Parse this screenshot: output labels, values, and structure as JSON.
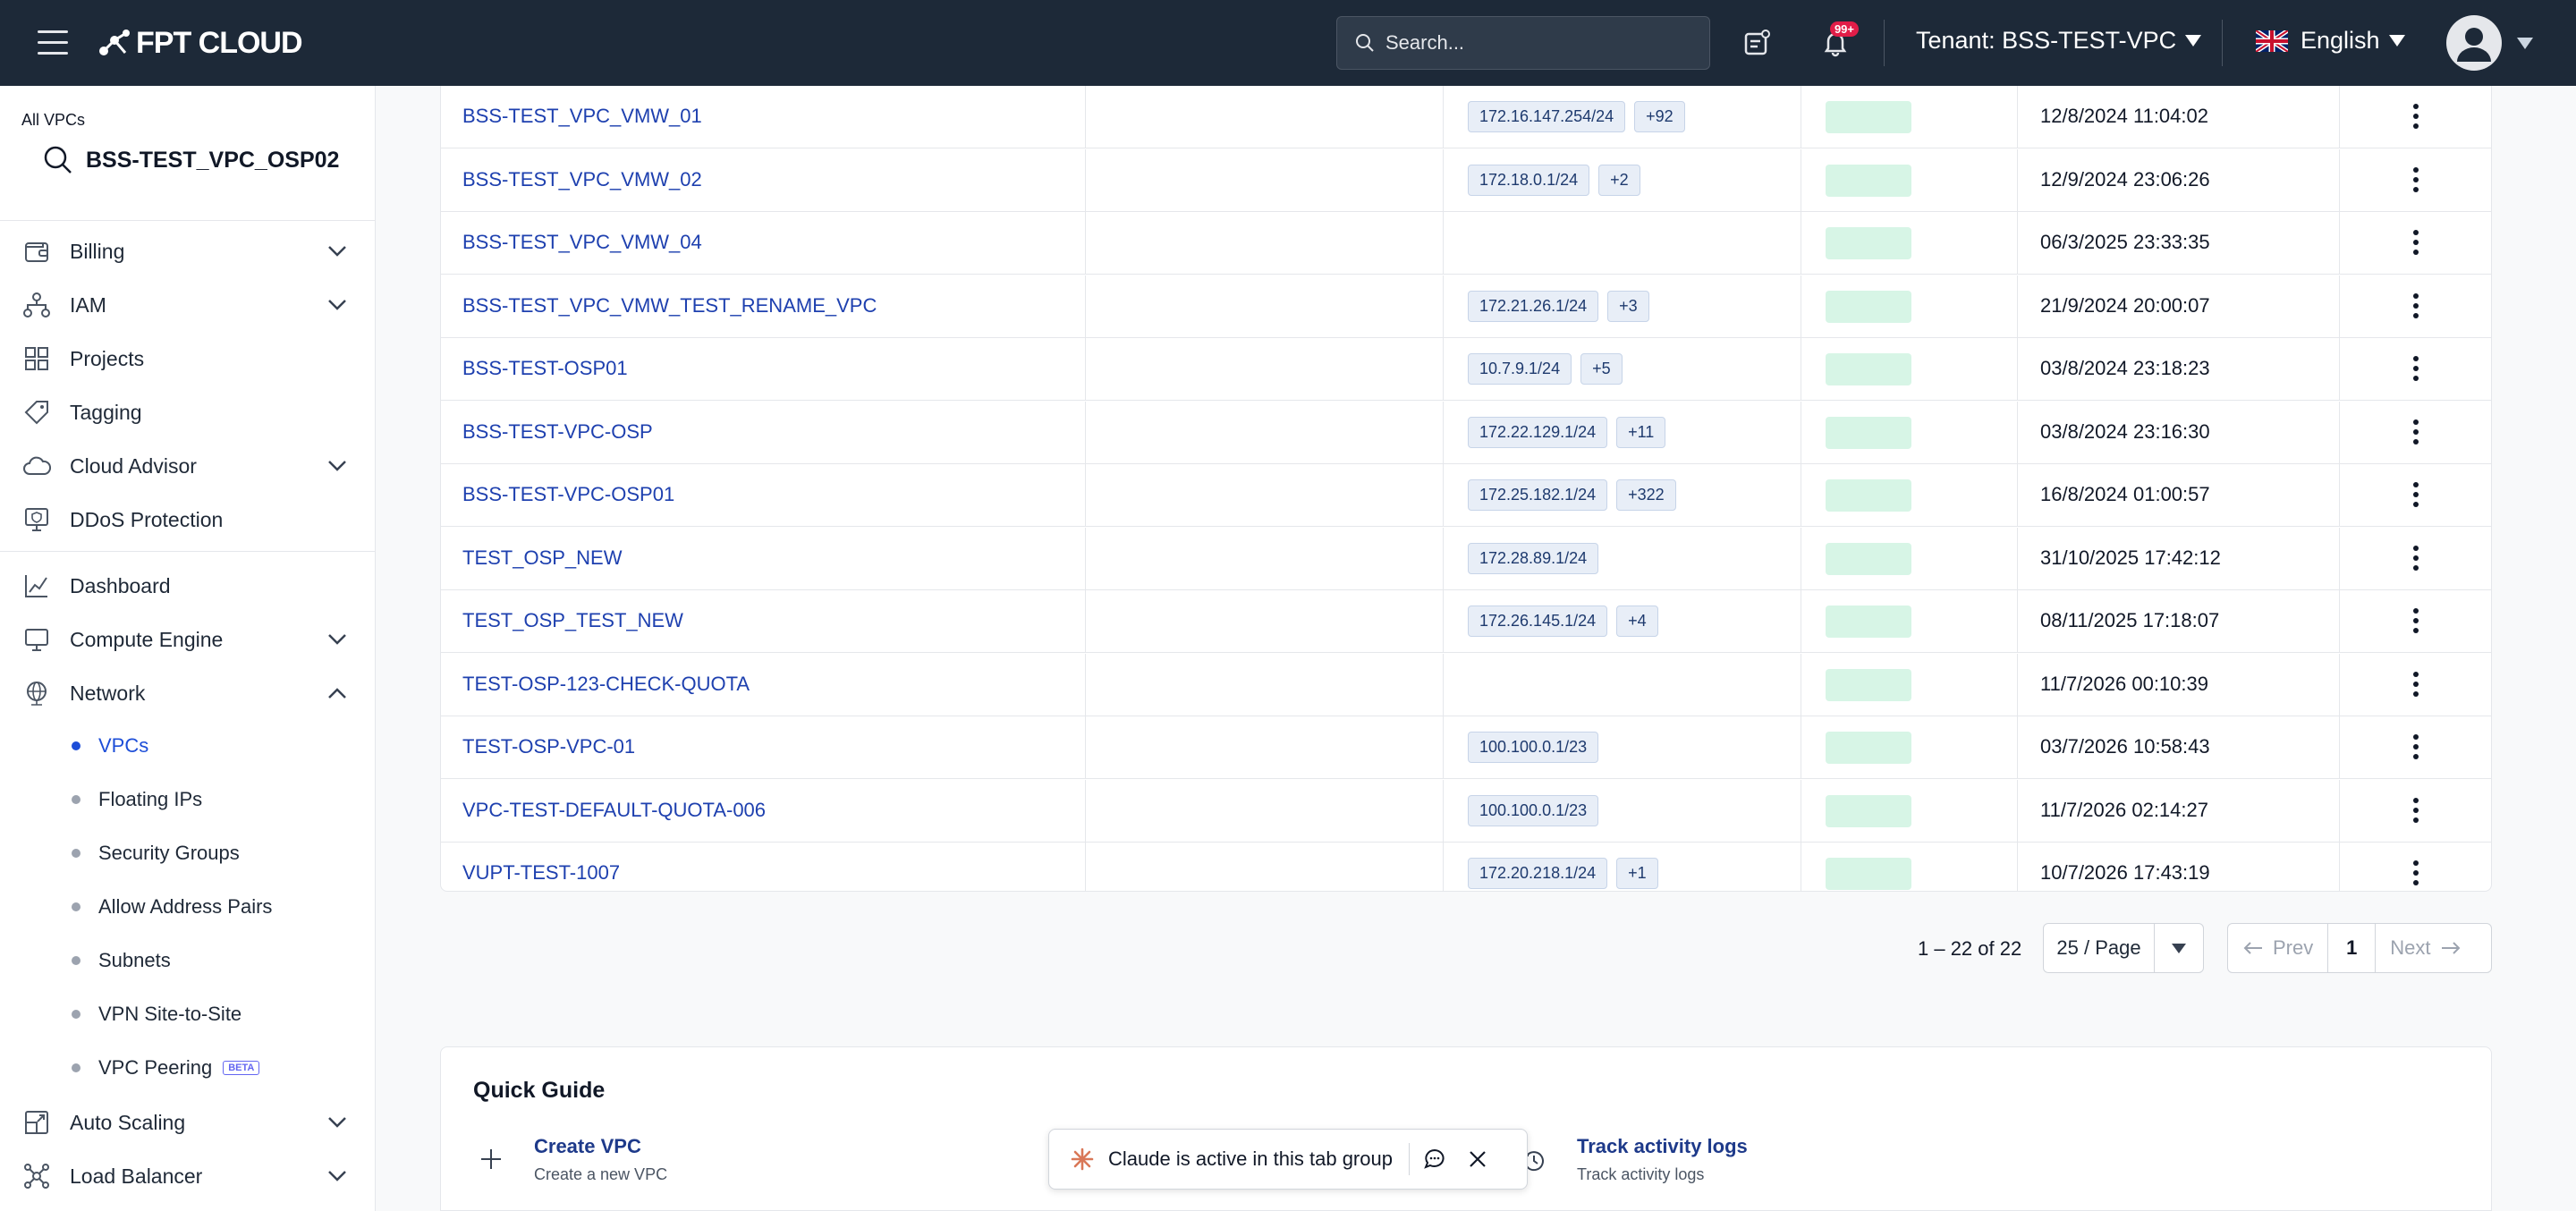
{
  "header": {
    "logo_text": "FPT CLOUD",
    "search_placeholder": "Search...",
    "notification_count": "99+",
    "tenant_label": "Tenant:",
    "tenant_value": "BSS-TEST-VPC",
    "language": "English"
  },
  "sidebar": {
    "context_title": "All VPCs",
    "context_search_value": "BSS-TEST_VPC_OSP02",
    "items": [
      {
        "label": "Billing",
        "icon": "wallet-icon",
        "expandable": true,
        "expanded": false
      },
      {
        "label": "IAM",
        "icon": "hierarchy-icon",
        "expandable": true,
        "expanded": false
      },
      {
        "label": "Projects",
        "icon": "grid-icon",
        "expandable": false
      },
      {
        "label": "Tagging",
        "icon": "tag-icon",
        "expandable": false
      },
      {
        "label": "Cloud Advisor",
        "icon": "cloud-icon",
        "expandable": true,
        "expanded": false
      },
      {
        "label": "DDoS Protection",
        "icon": "shield-monitor-icon",
        "expandable": false
      },
      {
        "label": "Dashboard",
        "icon": "chart-icon",
        "expandable": false
      },
      {
        "label": "Compute Engine",
        "icon": "monitor-icon",
        "expandable": true,
        "expanded": false
      },
      {
        "label": "Network",
        "icon": "globe-icon",
        "expandable": true,
        "expanded": true
      },
      {
        "label": "Auto Scaling",
        "icon": "scaling-icon",
        "expandable": true,
        "expanded": false
      },
      {
        "label": "Load Balancer",
        "icon": "balancer-icon",
        "expandable": true,
        "expanded": false
      }
    ],
    "network_sub_items": [
      {
        "label": "VPCs",
        "active": true
      },
      {
        "label": "Floating IPs",
        "active": false
      },
      {
        "label": "Security Groups",
        "active": false
      },
      {
        "label": "Allow Address Pairs",
        "active": false
      },
      {
        "label": "Subnets",
        "active": false
      },
      {
        "label": "VPN Site-to-Site",
        "active": false
      },
      {
        "label": "VPC Peering",
        "active": false,
        "badge": "BETA"
      }
    ]
  },
  "table": {
    "rows": [
      {
        "name": "BSS-TEST_VPC_VMW_01",
        "cidr": "172.16.147.254/24",
        "extra": "+92",
        "created": "12/8/2024 11:04:02"
      },
      {
        "name": "BSS-TEST_VPC_VMW_02",
        "cidr": "172.18.0.1/24",
        "extra": "+2",
        "created": "12/9/2024 23:06:26"
      },
      {
        "name": "BSS-TEST_VPC_VMW_04",
        "cidr": "",
        "extra": "",
        "created": "06/3/2025 23:33:35"
      },
      {
        "name": "BSS-TEST_VPC_VMW_TEST_RENAME_VPC",
        "cidr": "172.21.26.1/24",
        "extra": "+3",
        "created": "21/9/2024 20:00:07"
      },
      {
        "name": "BSS-TEST-OSP01",
        "cidr": "10.7.9.1/24",
        "extra": "+5",
        "created": "03/8/2024 23:18:23"
      },
      {
        "name": "BSS-TEST-VPC-OSP",
        "cidr": "172.22.129.1/24",
        "extra": "+11",
        "created": "03/8/2024 23:16:30"
      },
      {
        "name": "BSS-TEST-VPC-OSP01",
        "cidr": "172.25.182.1/24",
        "extra": "+322",
        "created": "16/8/2024 01:00:57"
      },
      {
        "name": "TEST_OSP_NEW",
        "cidr": "172.28.89.1/24",
        "extra": "",
        "created": "31/10/2025 17:42:12"
      },
      {
        "name": "TEST_OSP_TEST_NEW",
        "cidr": "172.26.145.1/24",
        "extra": "+4",
        "created": "08/11/2025 17:18:07"
      },
      {
        "name": "TEST-OSP-123-CHECK-QUOTA",
        "cidr": "",
        "extra": "",
        "created": "11/7/2026 00:10:39"
      },
      {
        "name": "TEST-OSP-VPC-01",
        "cidr": "100.100.0.1/23",
        "extra": "",
        "created": "03/7/2026 10:58:43"
      },
      {
        "name": "VPC-TEST-DEFAULT-QUOTA-006",
        "cidr": "100.100.0.1/23",
        "extra": "",
        "created": "11/7/2026 02:14:27"
      },
      {
        "name": "VUPT-TEST-1007",
        "cidr": "172.20.218.1/24",
        "extra": "+1",
        "created": "10/7/2026 17:43:19"
      }
    ]
  },
  "pagination": {
    "range_text": "1 – 22 of 22",
    "page_size": "25 / Page",
    "prev_label": "Prev",
    "current_page": "1",
    "next_label": "Next"
  },
  "quick_guide": {
    "title": "Quick Guide",
    "items": [
      {
        "title": "Create VPC",
        "subtitle": "Create a new VPC",
        "icon": "plus-icon"
      },
      {
        "title": "Track activity logs",
        "subtitle": "Track activity logs",
        "icon": "history-icon"
      }
    ]
  },
  "claude_toast": {
    "message": "Claude is active in this tab group"
  },
  "colors": {
    "header_bg": "#1d2938",
    "link": "#1e40af",
    "status_active": "#d7f5e6",
    "notification_badge": "#e11d48"
  }
}
